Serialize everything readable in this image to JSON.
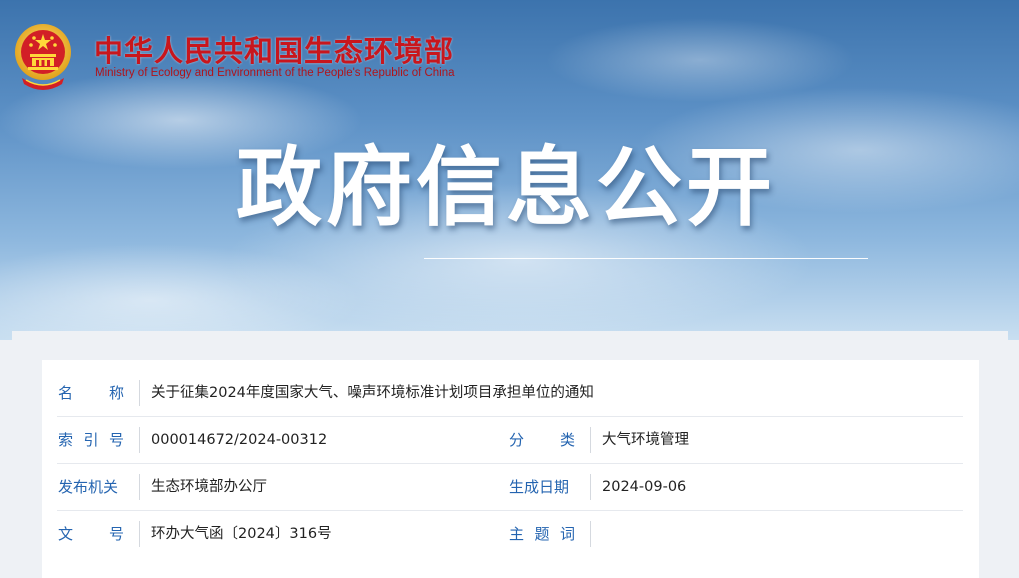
{
  "header": {
    "ministry_name_cn": "中华人民共和国生态环境部",
    "ministry_name_en": "Ministry of Ecology and Environment of the People's Republic of China",
    "page_title": "政府信息公开"
  },
  "info_table": {
    "name": {
      "label": [
        "名",
        "称"
      ],
      "value": "关于征集2024年度国家大气、噪声环境标准计划项目承担单位的通知"
    },
    "index_no": {
      "label": [
        "索",
        "引",
        "号"
      ],
      "value": "000014672/2024-00312"
    },
    "category": {
      "label": [
        "分",
        "类"
      ],
      "value": "大气环境管理"
    },
    "issuer": {
      "label": [
        "发布机关"
      ],
      "value": "生态环境部办公厅"
    },
    "date": {
      "label": [
        "生成日期"
      ],
      "value": "2024-09-06"
    },
    "doc_no": {
      "label": [
        "文",
        "号"
      ],
      "value": "环办大气函〔2024〕316号"
    },
    "subject_words": {
      "label": [
        "主",
        "题",
        "词"
      ],
      "value": ""
    }
  },
  "colors": {
    "ministry_red": "#c8161d",
    "label_blue": "#2464b0",
    "emblem_gold": "#f1c232"
  },
  "icons": {
    "emblem": "national-emblem-icon"
  }
}
